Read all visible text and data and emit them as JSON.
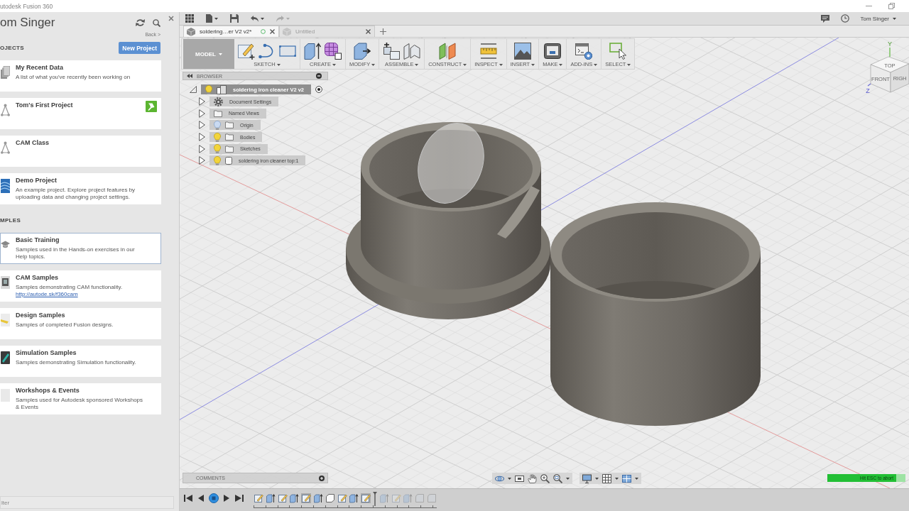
{
  "window": {
    "title": "utodesk Fusion 360"
  },
  "data_panel": {
    "user_name": "om Singer",
    "back_link": "Back >",
    "sections": [
      {
        "heading": "OJECTS",
        "button": "New Project",
        "cards": [
          {
            "title": "My Recent Data",
            "description": "A list of what you've recently been working on",
            "pinned": false,
            "selected": false
          },
          {
            "title": "Tom's First Project",
            "pinned": true,
            "selected": false
          },
          {
            "title": "CAM Class",
            "pinned": false,
            "selected": false
          },
          {
            "title": "Demo Project",
            "description": "An example project. Explore project features by uploading data and changing project settings.",
            "pinned": false,
            "selected": false
          }
        ]
      },
      {
        "heading": "MPLES",
        "cards": [
          {
            "title": "Basic Training",
            "description": "Samples used in the Hands-on exercises in our Help topics.",
            "pinned": false,
            "selected": true
          },
          {
            "title": "CAM Samples",
            "description": "Samples demonstrating CAM functionality.",
            "link": "http://autode.sk/f360cam",
            "pinned": false,
            "selected": false
          },
          {
            "title": "Design Samples",
            "description": "Samples of completed Fusion designs.",
            "pinned": false,
            "selected": false
          },
          {
            "title": "Simulation Samples",
            "description": "Samples demonstrating Simulation functionality.",
            "pinned": false,
            "selected": false
          },
          {
            "title": "Workshops & Events",
            "description": "Samples used for Autodesk sponsored Workshops & Events",
            "pinned": false,
            "selected": false
          }
        ]
      }
    ],
    "filter": {
      "placeholder": "lter"
    }
  },
  "app_bar": {
    "user_menu": "Tom Singer"
  },
  "document_tabs": [
    {
      "label": "soldering…er V2 v2*",
      "selected": true,
      "syncing": true
    },
    {
      "label": "Untitled",
      "selected": false,
      "syncing": false
    }
  ],
  "ribbon": {
    "workspace": "MODEL",
    "groups": [
      {
        "label": "SKETCH"
      },
      {
        "label": "CREATE"
      },
      {
        "label": "MODIFY"
      },
      {
        "label": "ASSEMBLE"
      },
      {
        "label": "CONSTRUCT"
      },
      {
        "label": "INSPECT"
      },
      {
        "label": "INSERT"
      },
      {
        "label": "MAKE"
      },
      {
        "label": "ADD-INS"
      },
      {
        "label": "SELECT"
      }
    ]
  },
  "browser": {
    "title": "BROWSER",
    "root": {
      "label": "soldering iron cleaner V2 v2",
      "expanded": true,
      "visible": true,
      "selected": true,
      "children": [
        {
          "label": "Document Settings",
          "kind": "settings",
          "expanded": false,
          "selected": false
        },
        {
          "label": "Named Views",
          "kind": "folder",
          "expanded": false,
          "selected": false
        },
        {
          "label": "Origin",
          "kind": "folder",
          "expanded": false,
          "visible": false,
          "selected": false
        },
        {
          "label": "Bodies",
          "kind": "folder",
          "expanded": false,
          "visible": true,
          "selected": false
        },
        {
          "label": "Sketches",
          "kind": "folder",
          "expanded": false,
          "visible": true,
          "selected": false
        },
        {
          "label": "soldering iron cleaner top:1",
          "kind": "component",
          "expanded": false,
          "visible": true,
          "selected": false
        }
      ]
    }
  },
  "view_cube": {
    "faces": [
      "TOP",
      "FRONT",
      "RIGH"
    ],
    "axes": [
      "Y",
      "Z"
    ]
  },
  "comments": {
    "title": "COMMENTS"
  },
  "status": {
    "message": "Hit ESC to abort",
    "level": 0.88
  },
  "timeline": {
    "features": [
      {
        "kind": "sketch",
        "selected": false,
        "rolled_back": false
      },
      {
        "kind": "extrude",
        "selected": false,
        "rolled_back": false
      },
      {
        "kind": "sketch",
        "selected": false,
        "rolled_back": false
      },
      {
        "kind": "extrude",
        "selected": false,
        "rolled_back": false
      },
      {
        "kind": "sketch",
        "selected": true,
        "rolled_back": false
      },
      {
        "kind": "extrude",
        "selected": false,
        "rolled_back": false
      },
      {
        "kind": "body",
        "selected": false,
        "rolled_back": false
      },
      {
        "kind": "sketch",
        "selected": false,
        "rolled_back": false
      },
      {
        "kind": "extrude",
        "selected": false,
        "rolled_back": false
      },
      {
        "kind": "sketch",
        "selected": true,
        "rolled_back": false
      },
      {
        "kind": "extrude",
        "selected": false,
        "rolled_back": true
      },
      {
        "kind": "sketch",
        "selected": false,
        "rolled_back": true
      },
      {
        "kind": "extrude",
        "selected": false,
        "rolled_back": true
      },
      {
        "kind": "fillet",
        "selected": false,
        "rolled_back": true
      },
      {
        "kind": "fillet",
        "selected": false,
        "rolled_back": true
      }
    ]
  }
}
